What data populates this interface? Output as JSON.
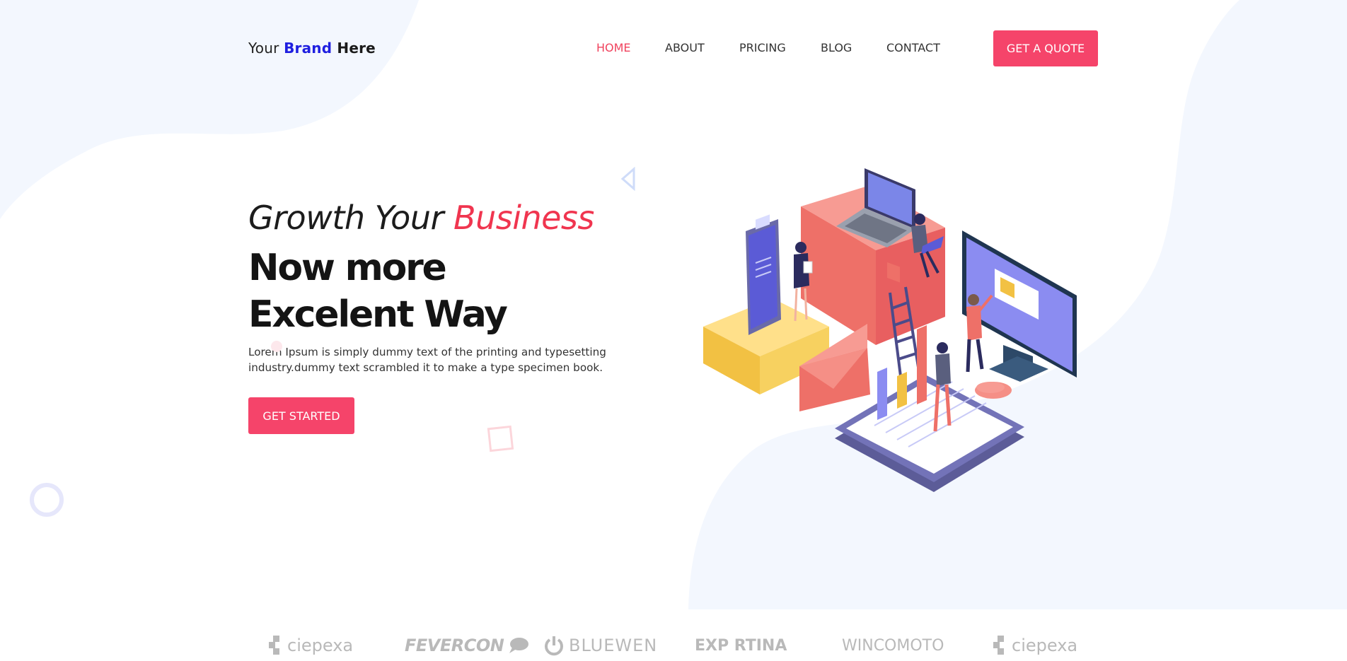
{
  "brand": {
    "prefix": "Your ",
    "highlight": "Brand",
    "suffix": " Here"
  },
  "nav": [
    {
      "label": "HOME",
      "active": true
    },
    {
      "label": "ABOUT",
      "active": false
    },
    {
      "label": "PRICING",
      "active": false
    },
    {
      "label": "BLOG",
      "active": false
    },
    {
      "label": "CONTACT",
      "active": false
    }
  ],
  "header": {
    "cta_label": "GET A QUOTE"
  },
  "hero": {
    "subtitle_prefix": "Growth Your ",
    "subtitle_accent": "Business",
    "title": "Now more Excelent Way",
    "description": "Lorem Ipsum is simply dummy text of the printing and typesetting industry.dummy text scrambled it to make a type specimen book.",
    "cta_label": "GET STARTED"
  },
  "partners": [
    {
      "name": "ciepexa",
      "icon": "ciepexa-logo-icon"
    },
    {
      "name": "FEVERCON",
      "icon": "speech-bubble-icon"
    },
    {
      "name": "BLUEWEN",
      "icon": "power-icon"
    },
    {
      "name": "EXP RTINA",
      "icon": "diamond-icon"
    },
    {
      "name": "WINCOMOTO",
      "icon": ""
    },
    {
      "name": "ciepexa",
      "icon": "ciepexa-logo-icon"
    }
  ],
  "colors": {
    "accent": "#f5446a",
    "brand_blue": "#1f1fe0",
    "background_blob": "#f3f7fe",
    "text_dark": "#141414"
  }
}
